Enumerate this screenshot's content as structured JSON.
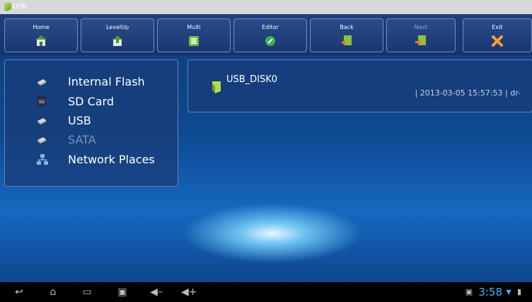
{
  "window": {
    "title": "USB"
  },
  "toolbar": {
    "buttons": [
      {
        "label": "Home",
        "icon": "home-icon"
      },
      {
        "label": "LevelUp",
        "icon": "levelup-icon"
      },
      {
        "label": "Multi",
        "icon": "multi-icon"
      },
      {
        "label": "Editor",
        "icon": "editor-icon"
      },
      {
        "label": "Back",
        "icon": "back-icon"
      },
      {
        "label": "Next",
        "icon": "next-icon",
        "disabled": true
      },
      {
        "label": "Exit",
        "icon": "exit-icon"
      }
    ]
  },
  "sidebar": {
    "items": [
      {
        "label": "Internal Flash",
        "icon": "drive-icon"
      },
      {
        "label": "SD Card",
        "icon": "sd-card-icon"
      },
      {
        "label": "USB",
        "icon": "drive-icon"
      },
      {
        "label": "SATA",
        "icon": "drive-icon",
        "disabled": true
      },
      {
        "label": "Network Places",
        "icon": "network-icon"
      }
    ]
  },
  "file_list": {
    "items": [
      {
        "name": "USB_DISK0",
        "details": "| 2013-03-05 15:57:53 | dr-"
      }
    ]
  },
  "status_bar": {
    "time": "3:58"
  },
  "colors": {
    "accent": "#46b4ff",
    "toolbar_bg": "#16336a"
  }
}
